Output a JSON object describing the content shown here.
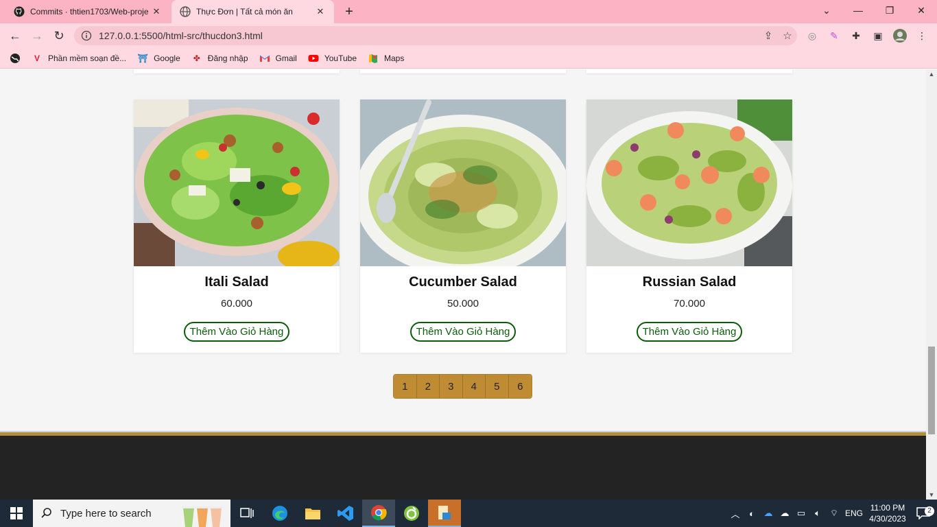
{
  "browser": {
    "tabs": [
      {
        "title": "Commits · thtien1703/Web-proje",
        "active": false
      },
      {
        "title": "Thực Đơn | Tất cả món ăn",
        "active": true
      }
    ],
    "url": "127.0.0.1:5500/html-src/thucdon3.html",
    "bookmarks": [
      {
        "label": "Phần mềm soạn đề...",
        "icon": "vietjack-icon"
      },
      {
        "label": "Google",
        "icon": "google-icon"
      },
      {
        "label": "Đăng nhập",
        "icon": "login-icon"
      },
      {
        "label": "Gmail",
        "icon": "gmail-icon"
      },
      {
        "label": "YouTube",
        "icon": "youtube-icon"
      },
      {
        "label": "Maps",
        "icon": "maps-icon"
      }
    ]
  },
  "menu": {
    "add_label": "Thêm Vào Giỏ Hàng",
    "items": [
      {
        "name": "Itali Salad",
        "price": "60.000"
      },
      {
        "name": "Cucumber Salad",
        "price": "50.000"
      },
      {
        "name": "Russian Salad",
        "price": "70.000"
      }
    ]
  },
  "pagination": {
    "pages": [
      "1",
      "2",
      "3",
      "4",
      "5",
      "6"
    ]
  },
  "colors": {
    "tabbar": "#fcb4c4",
    "toolbar": "#ffd9e2",
    "button_green": "#0b5b0b",
    "pager_gold": "#bf8c34",
    "footer": "#232323"
  },
  "taskbar": {
    "search_placeholder": "Type here to search",
    "language": "ENG",
    "time": "11:00 PM",
    "date": "4/30/2023",
    "notifications": "2"
  }
}
